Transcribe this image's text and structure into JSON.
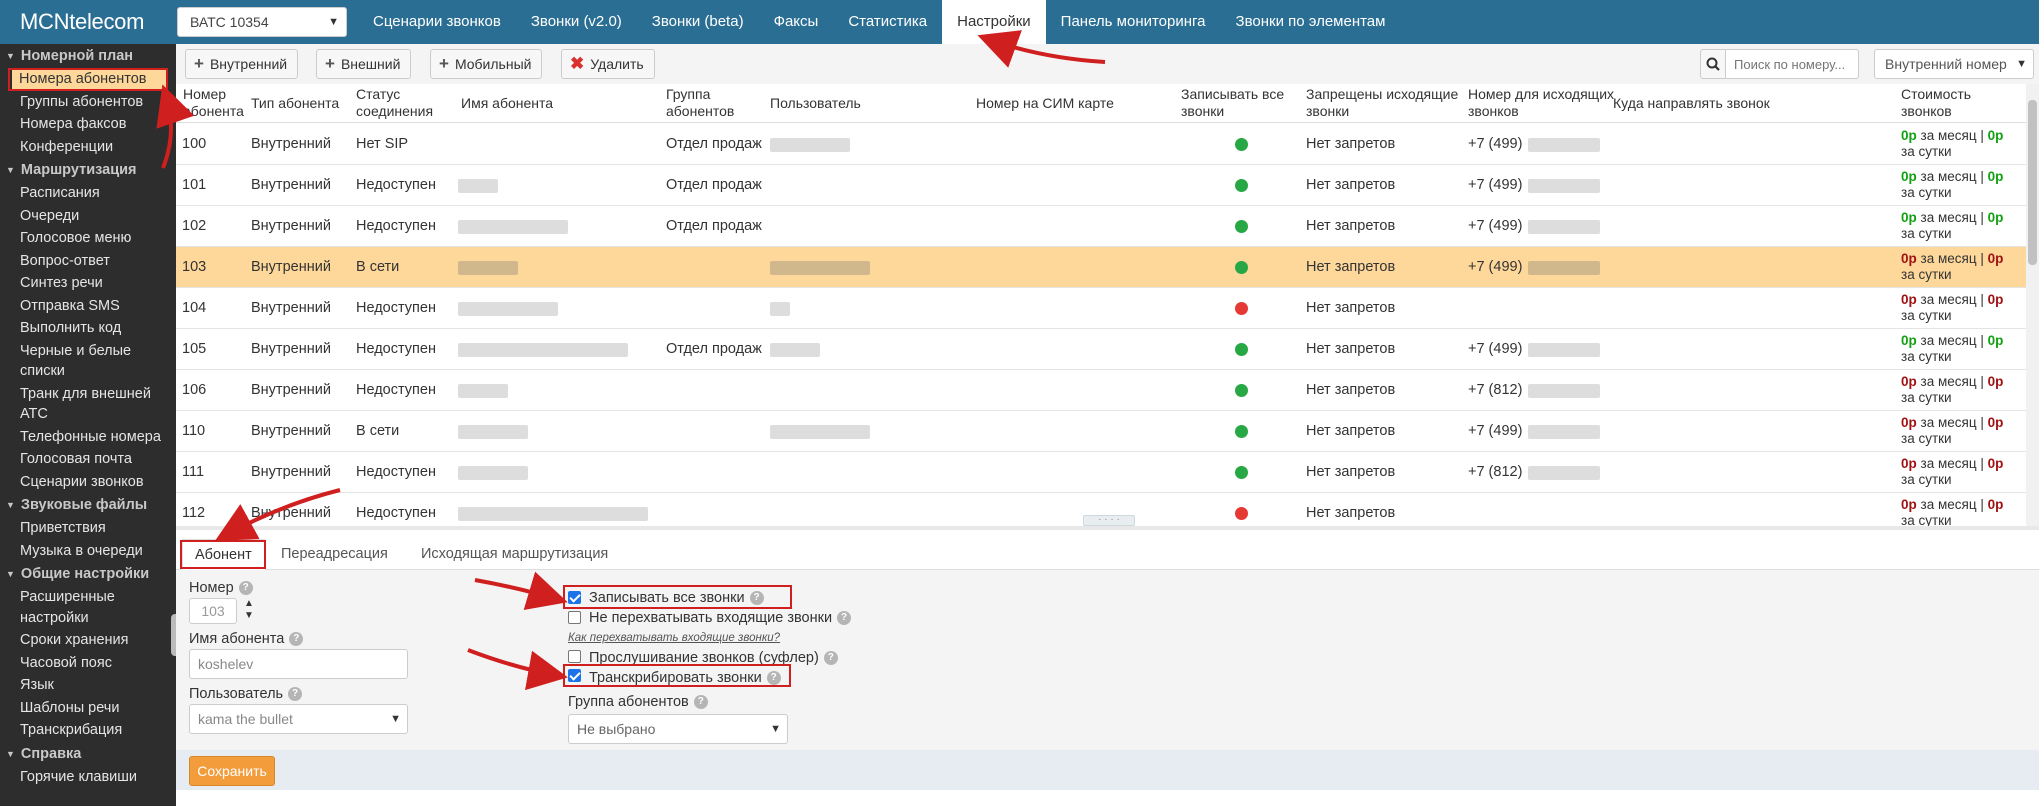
{
  "brand": "MCNtelecom",
  "vatc_select": "ВАТС 10354",
  "topnav": [
    {
      "label": "Сценарии звонков",
      "active": false
    },
    {
      "label": "Звонки (v2.0)",
      "active": false
    },
    {
      "label": "Звонки (beta)",
      "active": false
    },
    {
      "label": "Факсы",
      "active": false
    },
    {
      "label": "Статистика",
      "active": false
    },
    {
      "label": "Настройки",
      "active": true
    },
    {
      "label": "Панель мониторинга",
      "active": false
    },
    {
      "label": "Звонки по элементам",
      "active": false
    }
  ],
  "sidebar": {
    "sections": [
      {
        "title": "Номерной план",
        "items": [
          "Номера абонентов",
          "Группы абонентов",
          "Номера факсов",
          "Конференции"
        ]
      },
      {
        "title": "Маршрутизация",
        "items": [
          "Расписания",
          "Очереди",
          "Голосовое меню",
          "Вопрос-ответ",
          "Синтез речи",
          "Отправка SMS",
          "Выполнить код",
          "Черные и белые списки",
          "Транк для внешней АТС",
          "Телефонные номера",
          "Голосовая почта",
          "Сценарии звонков"
        ]
      },
      {
        "title": "Звуковые файлы",
        "items": [
          "Приветствия",
          "Музыка в очереди"
        ]
      },
      {
        "title": "Общие настройки",
        "items": [
          "Расширенные настройки",
          "Сроки хранения",
          "Часовой пояс",
          "Язык",
          "Шаблоны речи",
          "Транскрибация"
        ]
      },
      {
        "title": "Справка",
        "items": [
          "Горячие клавиши"
        ]
      }
    ],
    "active": "Номера абонентов"
  },
  "toolbar": {
    "internal": "Внутренний",
    "external": "Внешний",
    "mobile": "Мобильный",
    "delete": "Удалить",
    "search_placeholder": "Поиск по номеру...",
    "type_filter": "Внутренний номер"
  },
  "table": {
    "headers": {
      "number": "Номер абонента",
      "type": "Тип абонента",
      "status": "Статус соединения",
      "name": "Имя абонента",
      "group": "Группа абонентов",
      "user": "Пользователь",
      "sim": "Номер на СИМ карте",
      "record": "Записывать все звонки",
      "outgoing": "Запрещены исходящие звонки",
      "caller_id": "Номер для исходящих звонков",
      "redirect": "Куда направлять звонок",
      "cost": "Стоимость звонков"
    },
    "rows": [
      {
        "number": "100",
        "type": "Внутренний",
        "status": "Нет SIP",
        "group": "Отдел продаж",
        "record": true,
        "outgoing": "Нет запретов",
        "caller_id": "+7 (499)",
        "month": "0р",
        "day": "0р",
        "cost_ok": true,
        "selected": false
      },
      {
        "number": "101",
        "type": "Внутренний",
        "status": "Недоступен",
        "group": "Отдел продаж",
        "record": true,
        "outgoing": "Нет запретов",
        "caller_id": "+7 (499)",
        "month": "0р",
        "day": "0р",
        "cost_ok": true,
        "selected": false
      },
      {
        "number": "102",
        "type": "Внутренний",
        "status": "Недоступен",
        "group": "Отдел продаж",
        "record": true,
        "outgoing": "Нет запретов",
        "caller_id": "+7 (499)",
        "month": "0р",
        "day": "0р",
        "cost_ok": true,
        "selected": false
      },
      {
        "number": "103",
        "type": "Внутренний",
        "status": "В сети",
        "group": "",
        "record": true,
        "outgoing": "Нет запретов",
        "caller_id": "+7 (499)",
        "month": "0р",
        "day": "0р",
        "cost_ok": false,
        "selected": true
      },
      {
        "number": "104",
        "type": "Внутренний",
        "status": "Недоступен",
        "group": "",
        "record": false,
        "outgoing": "Нет запретов",
        "caller_id": "",
        "month": "0р",
        "day": "0р",
        "cost_ok": false,
        "selected": false
      },
      {
        "number": "105",
        "type": "Внутренний",
        "status": "Недоступен",
        "group": "Отдел продаж",
        "record": true,
        "outgoing": "Нет запретов",
        "caller_id": "+7 (499)",
        "month": "0р",
        "day": "0р",
        "cost_ok": true,
        "selected": false
      },
      {
        "number": "106",
        "type": "Внутренний",
        "status": "Недоступен",
        "group": "",
        "record": true,
        "outgoing": "Нет запретов",
        "caller_id": "+7 (812)",
        "month": "0р",
        "day": "0р",
        "cost_ok": false,
        "selected": false
      },
      {
        "number": "110",
        "type": "Внутренний",
        "status": "В сети",
        "group": "",
        "record": true,
        "outgoing": "Нет запретов",
        "caller_id": "+7 (499)",
        "month": "0р",
        "day": "0р",
        "cost_ok": false,
        "selected": false
      },
      {
        "number": "111",
        "type": "Внутренний",
        "status": "Недоступен",
        "group": "",
        "record": true,
        "outgoing": "Нет запретов",
        "caller_id": "+7 (812)",
        "month": "0р",
        "day": "0р",
        "cost_ok": false,
        "selected": false
      },
      {
        "number": "112",
        "type": "Внутренний",
        "status": "Недоступен",
        "group": "",
        "record": false,
        "outgoing": "Нет запретов",
        "caller_id": "",
        "month": "0р",
        "day": "0р",
        "cost_ok": false,
        "selected": false
      }
    ],
    "cost_month_suffix": "за месяц",
    "cost_day_suffix": "за сутки"
  },
  "tabs": [
    "Абонент",
    "Переадресация",
    "Исходящая маршрутизация"
  ],
  "form": {
    "number_label": "Номер",
    "number_value": "103",
    "name_label": "Имя абонента",
    "name_value": "koshelev",
    "user_label": "Пользователь",
    "user_value": "kama the bullet",
    "cb_record": "Записывать все звонки",
    "cb_no_intercept": "Не перехватывать входящие звонки",
    "howto": "Как перехватывать входящие звонки?",
    "cb_listen": "Прослушивание звонков (суфлер)",
    "cb_transcribe": "Транскрибировать звонки",
    "group_label": "Группа абонентов",
    "group_value": "Не выбрано",
    "save": "Сохранить"
  },
  "colors": {
    "topbar": "#2a6f93",
    "sidebar": "#2d2d2d",
    "selected_row": "#fed89a",
    "save": "#f39c3c",
    "annotation": "#d01f1f"
  }
}
